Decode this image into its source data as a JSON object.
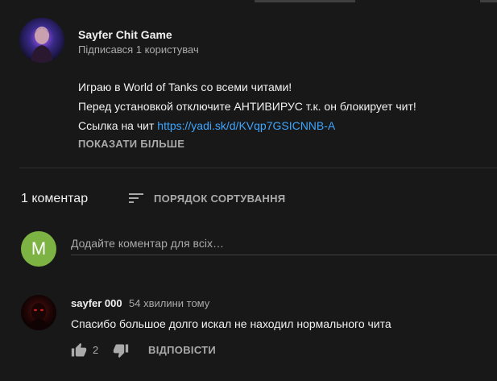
{
  "channel": {
    "name": "Sayfer Chit Game",
    "subscribers": "Підписався 1 користувач"
  },
  "description": {
    "line1": "Играю в World of Tanks со всеми читами!",
    "line2": "Перед установкой отключите АНТИВИРУС т.к. он блокирует чит!",
    "line3_prefix": "Ссылка на чит ",
    "link": "https://yadi.sk/d/KVqp7GSICNNB-A",
    "show_more": "ПОКАЗАТИ БІЛЬШЕ"
  },
  "comments_header": {
    "count": "1 коментар",
    "sort_label": "ПОРЯДОК СОРТУВАННЯ"
  },
  "add_comment": {
    "avatar_letter": "M",
    "avatar_color": "#7cb342",
    "placeholder": "Додайте коментар для всіх…"
  },
  "comment": {
    "author": "sayfer 000",
    "time": "54 хвилини тому",
    "text": "Спасибо большое долго искал не находил нормального чита",
    "likes": "2",
    "reply": "ВІДПОВІСТИ"
  },
  "colors": {
    "background": "#181818",
    "link": "#3ea6ff",
    "secondary_text": "#aaaaaa"
  }
}
